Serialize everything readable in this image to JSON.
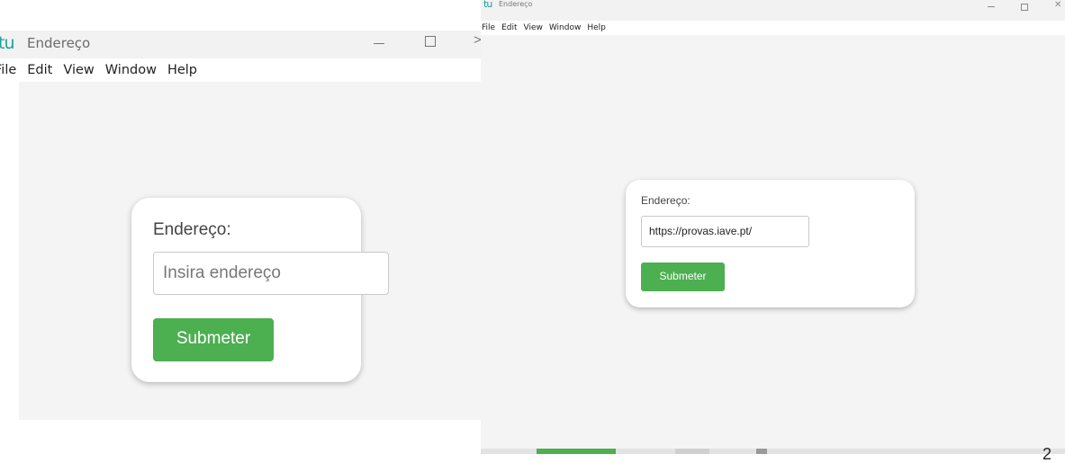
{
  "left_window": {
    "logo": "tu",
    "title": "Endereço",
    "menu": [
      "File",
      "Edit",
      "View",
      "Window",
      "Help"
    ],
    "form": {
      "label": "Endereço:",
      "placeholder": "Insira endereço",
      "value": "",
      "button_label": "Submeter"
    }
  },
  "right_window": {
    "logo": "tu",
    "title": "Endereço",
    "menu": [
      "File",
      "Edit",
      "View",
      "Window",
      "Help"
    ],
    "form": {
      "label": "Endereço:",
      "value": "https://provas.iave.pt/",
      "button_label": "Submeter"
    }
  },
  "corner_text": "2",
  "colors": {
    "accent": "#4caf50",
    "logo": "#1aa39a",
    "content_bg": "#f4f4f4"
  },
  "icons": {
    "minimize": "minimize-icon",
    "maximize": "maximize-icon",
    "close": "close-icon"
  }
}
